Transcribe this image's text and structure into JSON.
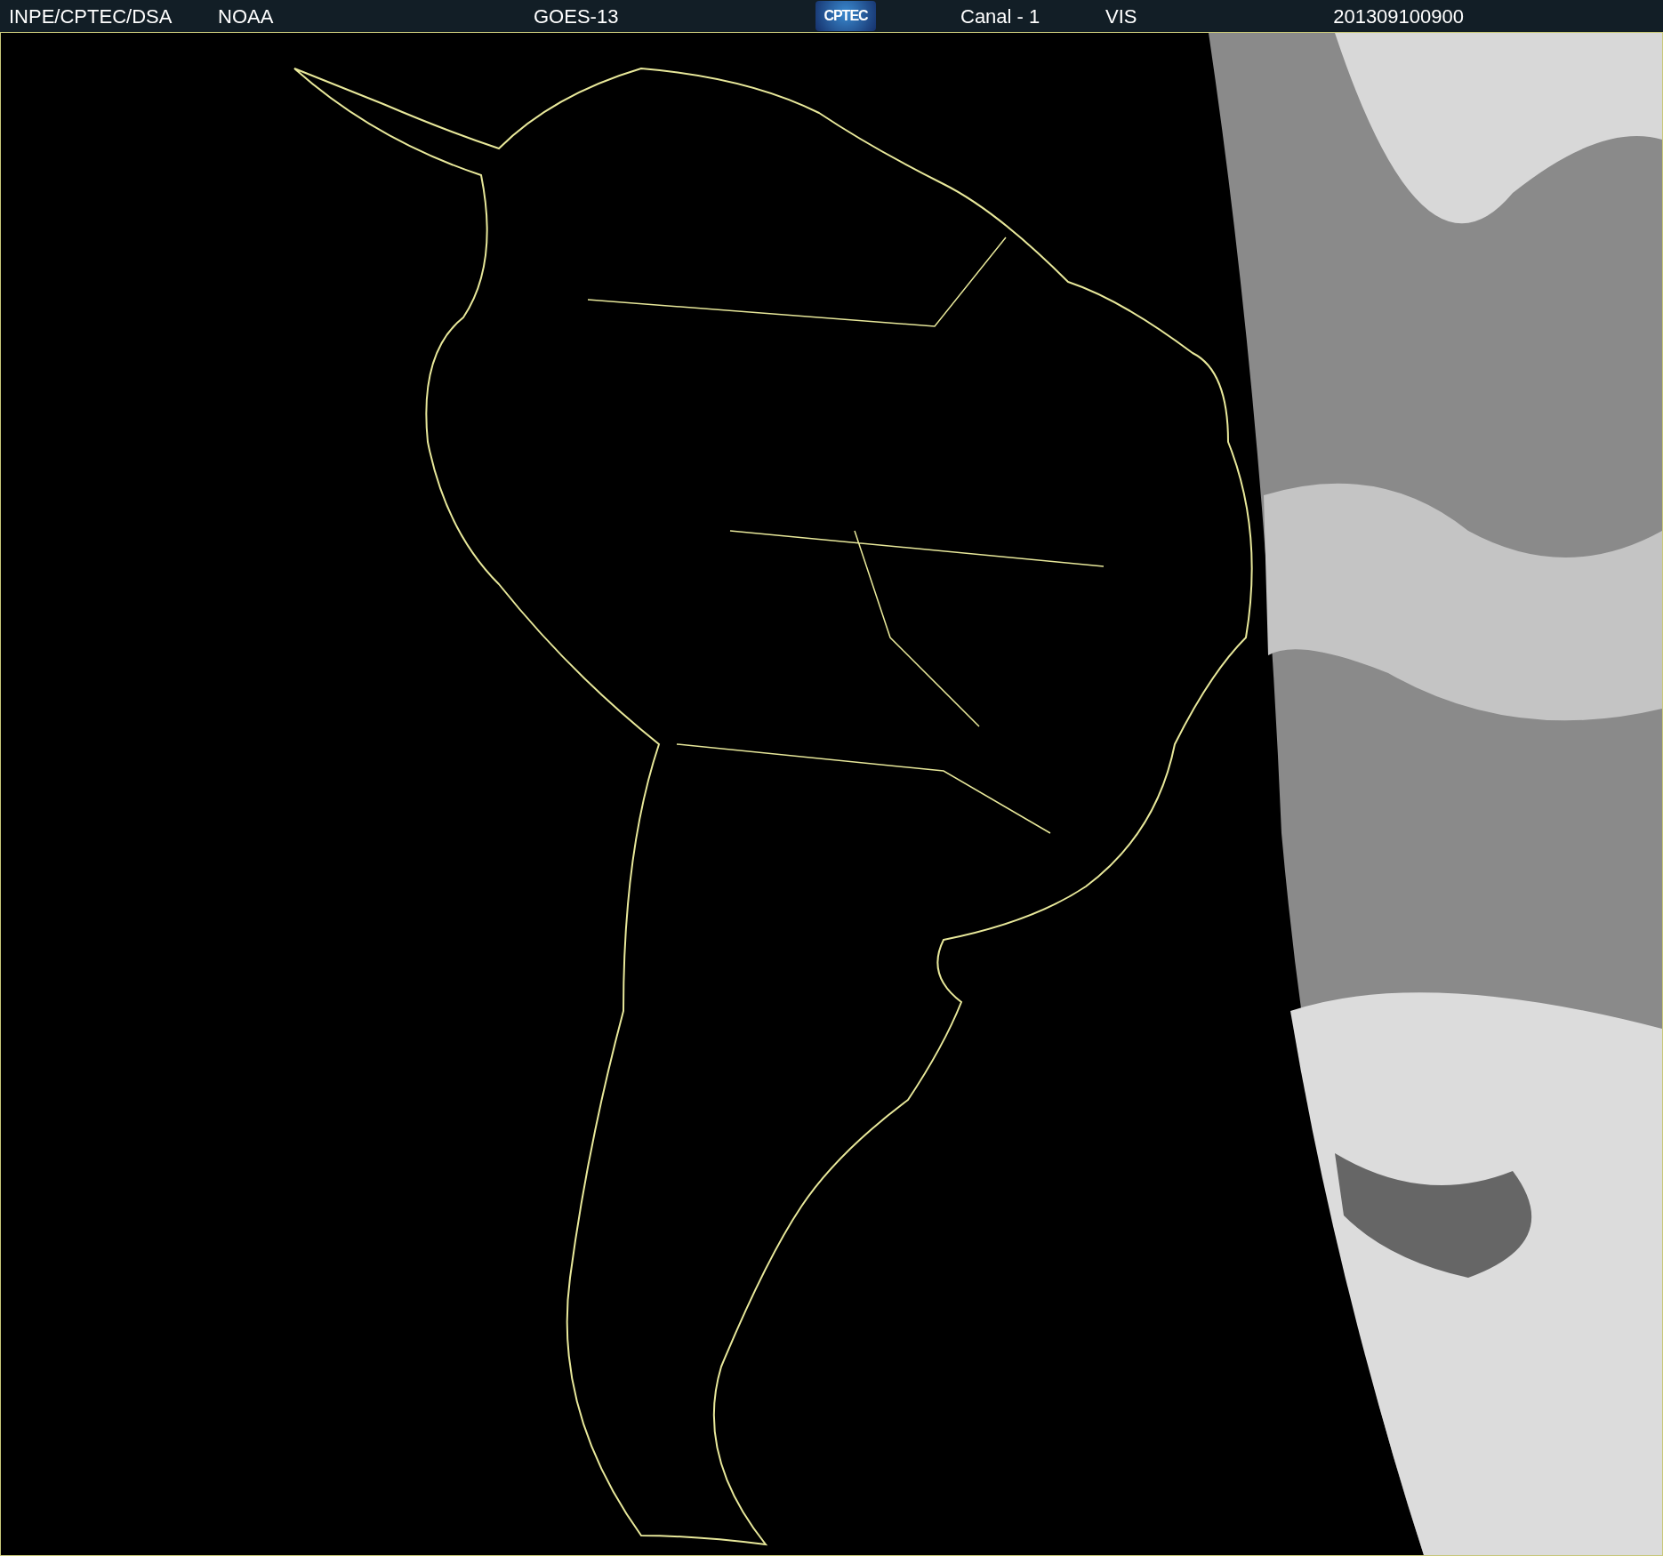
{
  "header": {
    "items": [
      {
        "kind": "text",
        "text": "INPE/CPTEC/DSA"
      },
      {
        "kind": "text",
        "text": "NOAA"
      },
      {
        "kind": "text",
        "text": "GOES-13"
      },
      {
        "kind": "logo",
        "text": "CPTEC"
      },
      {
        "kind": "text",
        "text": "Canal - 1"
      },
      {
        "kind": "text",
        "text": "VIS"
      },
      {
        "kind": "text",
        "text": "201309100900"
      }
    ]
  }
}
